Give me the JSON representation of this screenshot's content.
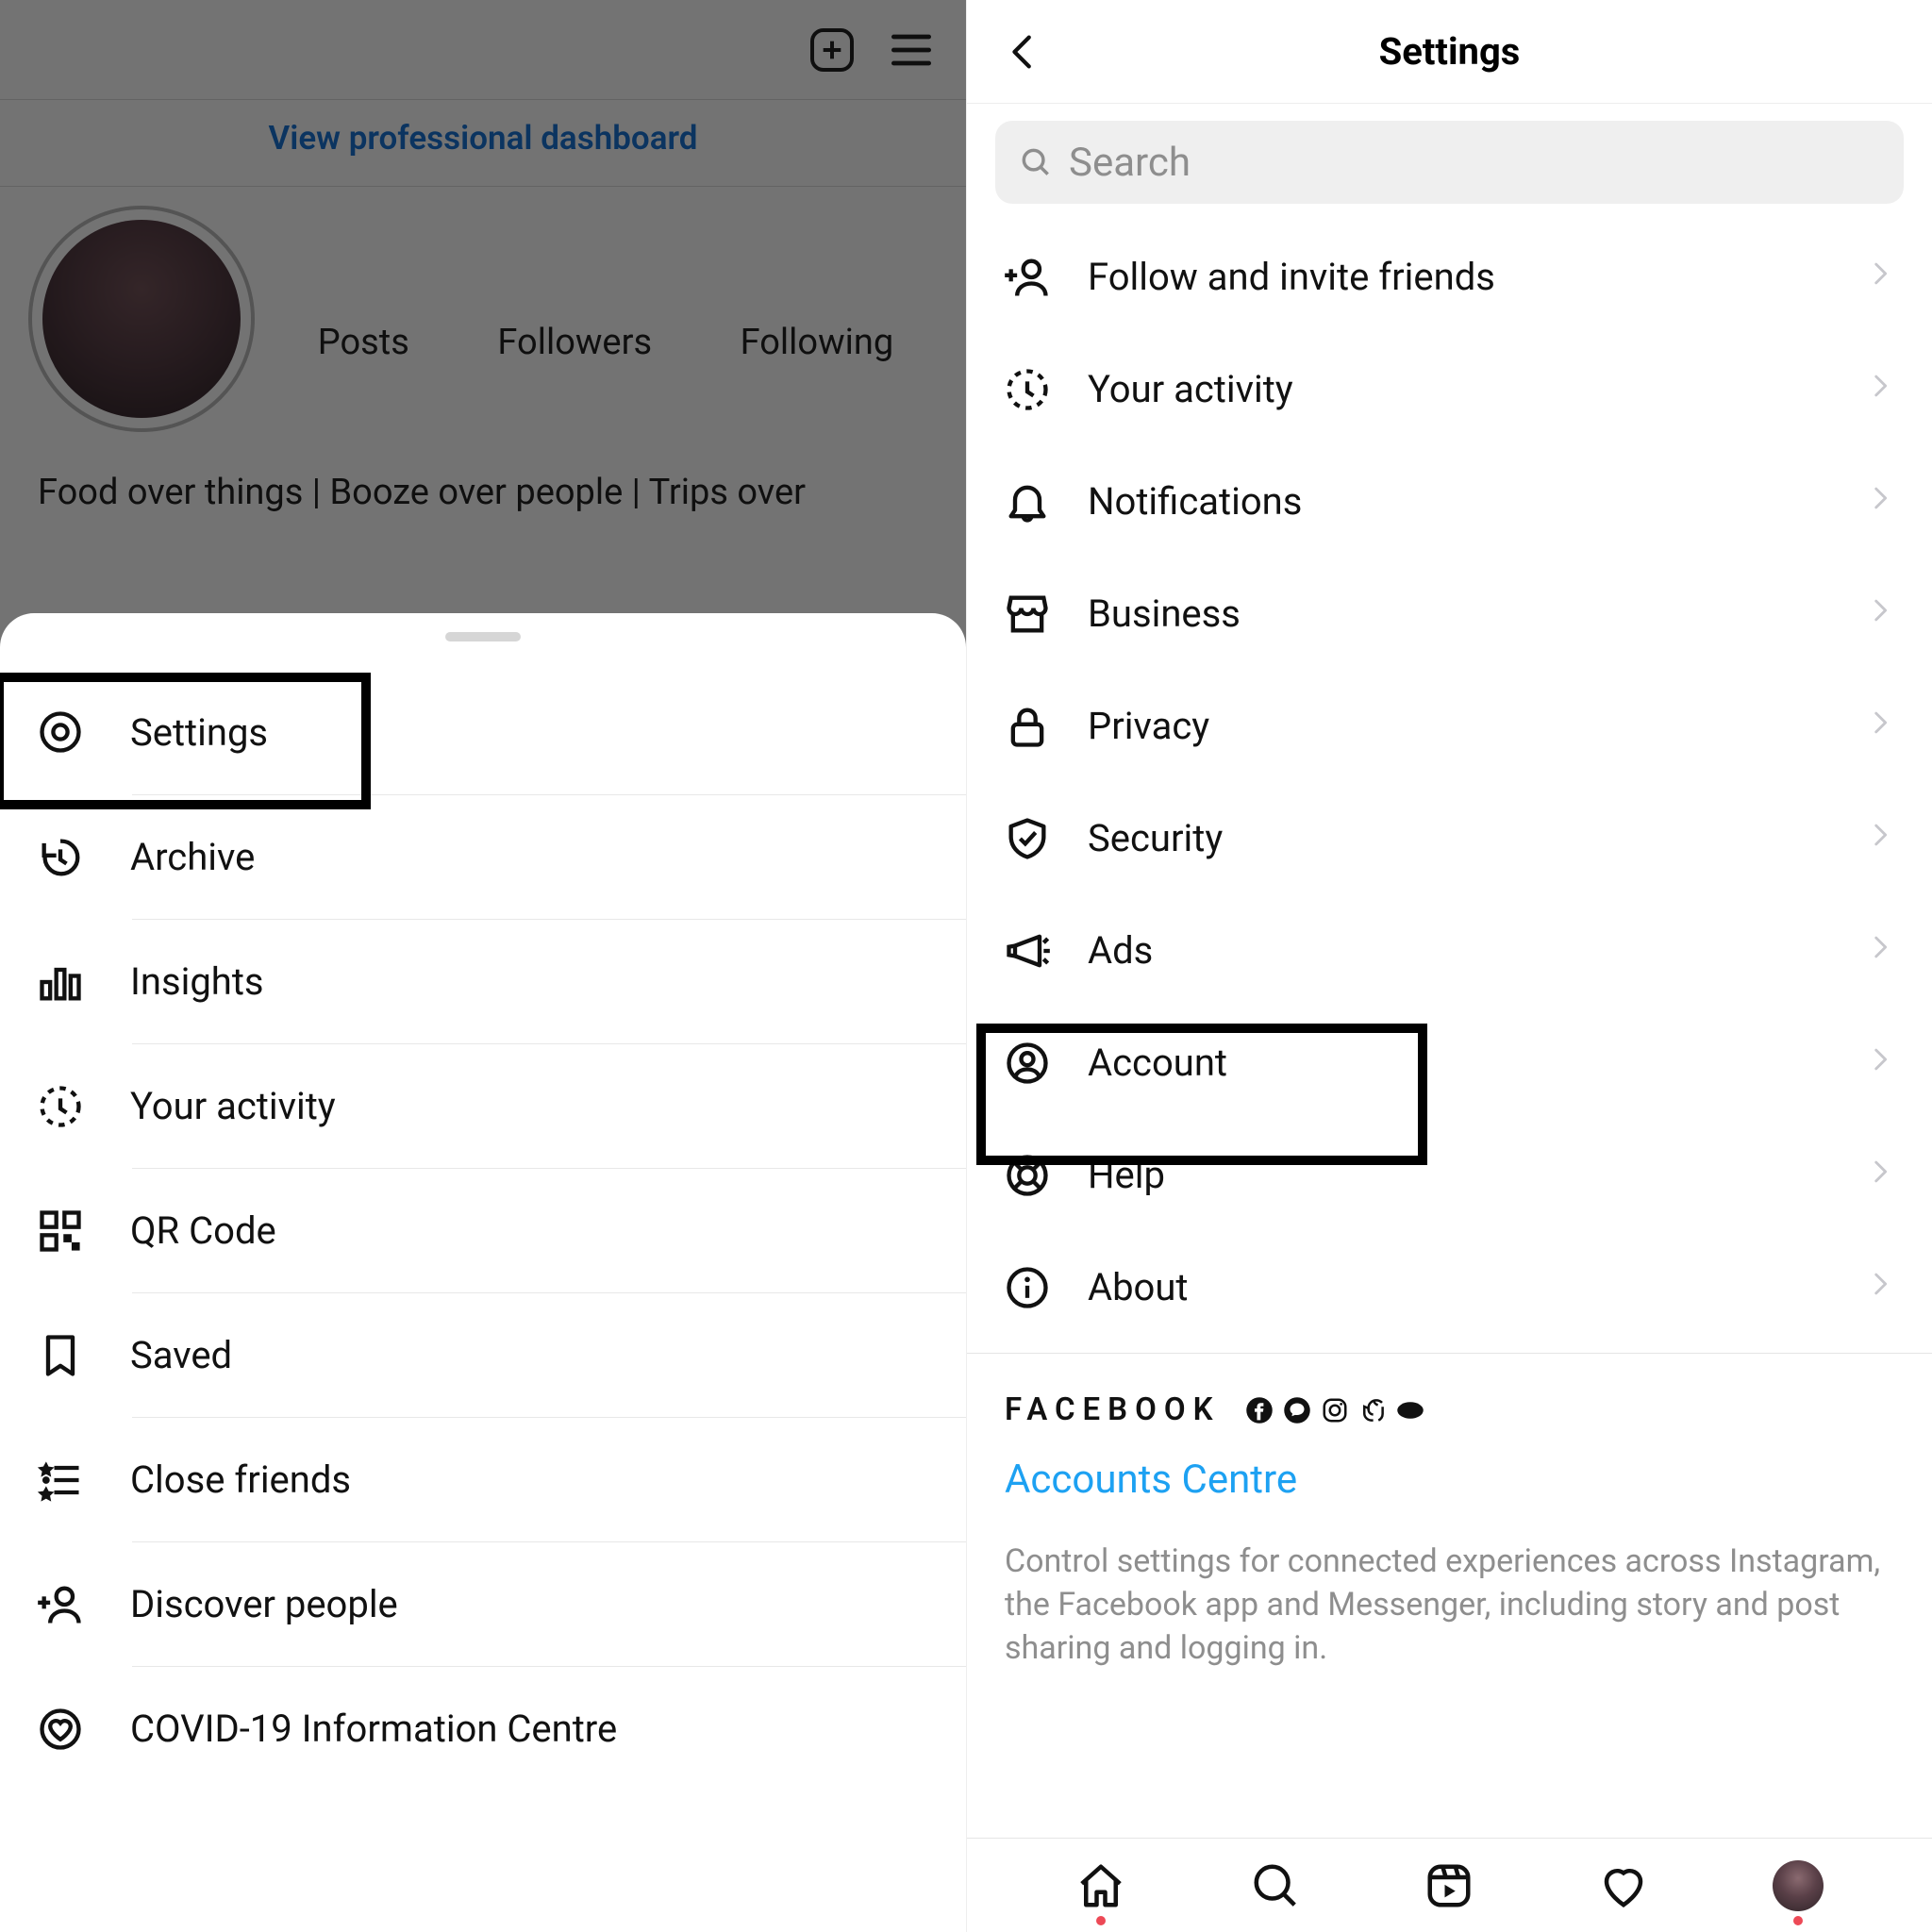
{
  "left": {
    "dashboard_link": "View professional dashboard",
    "stats": {
      "posts": "Posts",
      "followers": "Followers",
      "following": "Following"
    },
    "bio_line": "Food over things | Booze over people | Trips over",
    "sheet": {
      "items": [
        {
          "label": "Settings",
          "icon": "gear-icon"
        },
        {
          "label": "Archive",
          "icon": "history-icon"
        },
        {
          "label": "Insights",
          "icon": "bar-chart-icon"
        },
        {
          "label": "Your activity",
          "icon": "clock-dotted-icon"
        },
        {
          "label": "QR Code",
          "icon": "qr-code-icon"
        },
        {
          "label": "Saved",
          "icon": "bookmark-icon"
        },
        {
          "label": "Close friends",
          "icon": "star-list-icon"
        },
        {
          "label": "Discover people",
          "icon": "person-plus-icon"
        },
        {
          "label": "COVID-19 Information Centre",
          "icon": "heart-shield-icon"
        }
      ]
    }
  },
  "right": {
    "title": "Settings",
    "search_placeholder": "Search",
    "items": [
      {
        "label": "Follow and invite friends",
        "icon": "person-plus-icon"
      },
      {
        "label": "Your activity",
        "icon": "clock-dotted-icon"
      },
      {
        "label": "Notifications",
        "icon": "bell-icon"
      },
      {
        "label": "Business",
        "icon": "storefront-icon"
      },
      {
        "label": "Privacy",
        "icon": "lock-icon"
      },
      {
        "label": "Security",
        "icon": "shield-check-icon"
      },
      {
        "label": "Ads",
        "icon": "megaphone-icon"
      },
      {
        "label": "Account",
        "icon": "user-circle-icon"
      },
      {
        "label": "Help",
        "icon": "lifebuoy-icon"
      },
      {
        "label": "About",
        "icon": "info-icon"
      }
    ],
    "facebook_label": "FACEBOOK",
    "accounts_centre": "Accounts Centre",
    "accounts_desc": "Control settings for connected experiences across Instagram, the Facebook app and Messenger, including story and post sharing and logging in."
  },
  "colors": {
    "link_blue": "#1fa1f1",
    "highlight_border": "#000000"
  }
}
